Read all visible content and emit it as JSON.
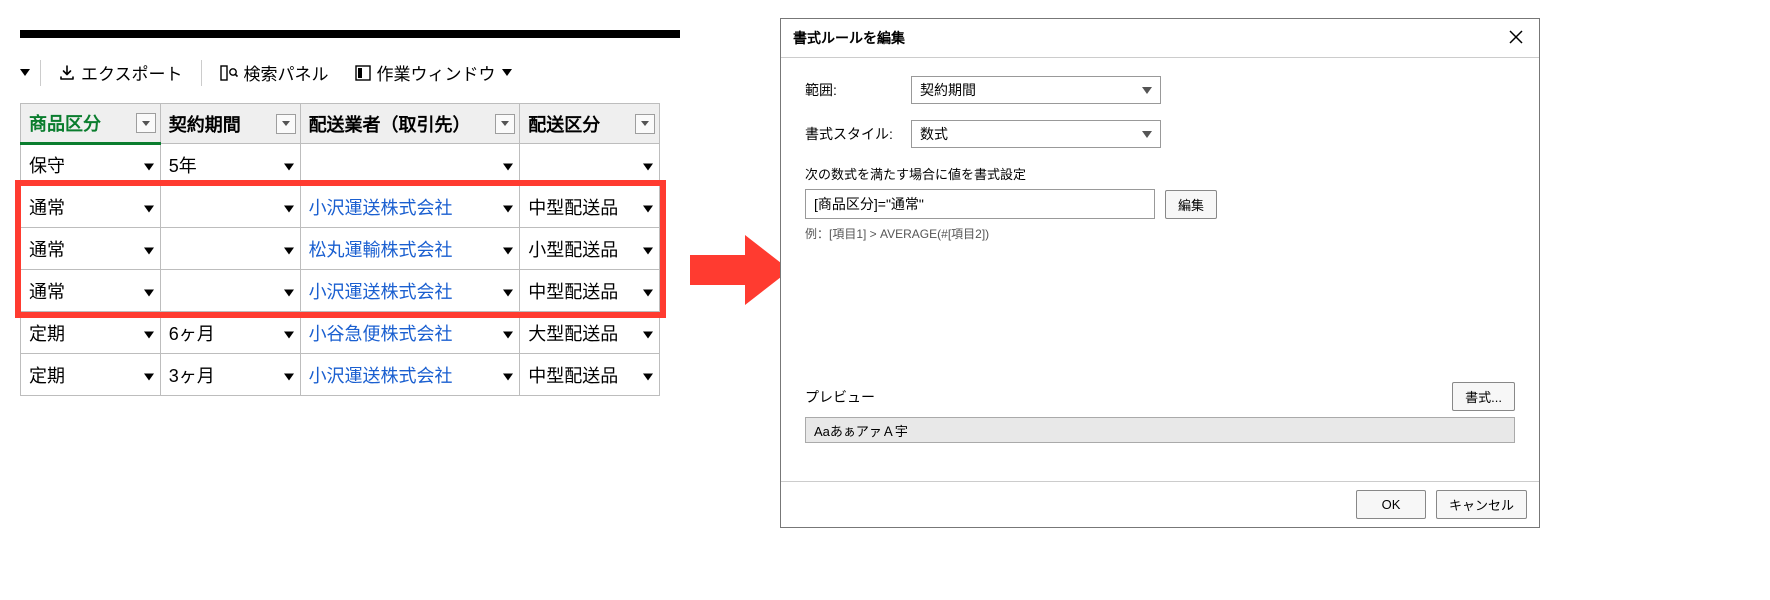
{
  "toolbar": {
    "export_label": "エクスポート",
    "search_panel_label": "検索パネル",
    "work_window_label": "作業ウィンドウ"
  },
  "table": {
    "columns": [
      "商品区分",
      "契約期間",
      "配送業者（取引先）",
      "配送区分"
    ],
    "rows": [
      {
        "c0": "保守",
        "c1": "5年",
        "c2": "",
        "c3": "",
        "grey": true,
        "link": false
      },
      {
        "c0": "通常",
        "c1": "",
        "c2": "小沢運送株式会社",
        "c3": "中型配送品",
        "grey": false,
        "link": true
      },
      {
        "c0": "通常",
        "c1": "",
        "c2": "松丸運輸株式会社",
        "c3": "小型配送品",
        "grey": false,
        "link": true
      },
      {
        "c0": "通常",
        "c1": "",
        "c2": "小沢運送株式会社",
        "c3": "中型配送品",
        "grey": false,
        "link": true
      },
      {
        "c0": "定期",
        "c1": "6ヶ月",
        "c2": "小谷急便株式会社",
        "c3": "大型配送品",
        "grey": false,
        "link": true
      },
      {
        "c0": "定期",
        "c1": "3ヶ月",
        "c2": "小沢運送株式会社",
        "c3": "中型配送品",
        "grey": false,
        "link": true
      }
    ]
  },
  "dialog": {
    "title": "書式ルールを編集",
    "range_label": "範囲:",
    "range_value": "契約期間",
    "style_label": "書式スタイル:",
    "style_value": "数式",
    "formula_section_label": "次の数式を満たす場合に値を書式設定",
    "formula_value": "[商品区分]=\"通常\"",
    "edit_btn": "編集",
    "example_text": "例：[項目1] > AVERAGE(#[項目2])",
    "preview_label": "プレビュー",
    "format_btn": "書式...",
    "preview_sample": "AaあぁアァＡ宇",
    "ok_btn": "OK",
    "cancel_btn": "キャンセル"
  }
}
